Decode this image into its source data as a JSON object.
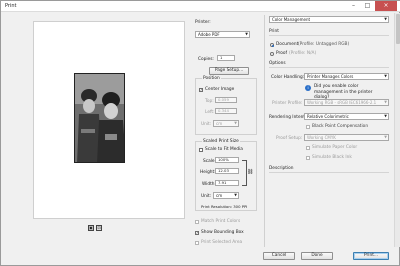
{
  "window": {
    "title": "Print",
    "minimize": "–",
    "maximize": "□",
    "close": "×"
  },
  "printer": {
    "label": "Printer:",
    "value": "Adobe PDF",
    "copies_label": "Copies:",
    "copies_value": "1",
    "page_setup": "Page Setup..."
  },
  "position": {
    "title": "Position",
    "center_image_label": "Center Image",
    "center_image_checked": true,
    "top_label": "Top:",
    "top_value": "0.059",
    "left_label": "Left:",
    "left_value": "0.344",
    "unit_label": "Unit:",
    "unit_value": "cm"
  },
  "scaled": {
    "title": "Scaled Print Size",
    "scale_to_fit_label": "Scale to Fit Media",
    "scale_label": "Scale:",
    "scale_value": "100%",
    "height_label": "Height:",
    "height_value": "12.03",
    "width_label": "Width:",
    "width_value": "7.91",
    "unit_label": "Unit:",
    "unit_value": "cm",
    "resolution": "Print Resolution: 300 PPI"
  },
  "options_left": {
    "match_print_colors": "Match Print Colors",
    "show_bounding_box": "Show Bounding Box",
    "show_bounding_box_checked": true,
    "print_selected_area": "Print Selected Area"
  },
  "right": {
    "mode_select": "Color Management",
    "print_heading": "Print",
    "document_label": "Document",
    "document_profile": "(Profile: Untagged RGB)",
    "proof_label": "Proof",
    "proof_profile": "(Profile: N/A)",
    "options_heading": "Options",
    "color_handling_label": "Color Handling:",
    "color_handling_value": "Printer Manages Colors",
    "enable_note": "Did you enable color management in the printer dialog?",
    "printer_profile_label": "Printer Profile:",
    "printer_profile_value": "Working RGB - sRGB IEC61966-2.1",
    "rendering_intent_label": "Rendering Intent:",
    "rendering_intent_value": "Relative Colorimetric",
    "bpc_label": "Black Point Compensation",
    "proof_setup_label": "Proof Setup:",
    "proof_setup_value": "Working CMYK",
    "simulate_paper": "Simulate Paper Color",
    "simulate_ink": "Simulate Black Ink",
    "description_heading": "Description"
  },
  "footer": {
    "cancel": "Cancel",
    "done": "Done",
    "print": "Print..."
  },
  "colors": {
    "accent": "#1a5fb4",
    "window_bg": "#f0f0f0",
    "paper": "#ffffff"
  }
}
